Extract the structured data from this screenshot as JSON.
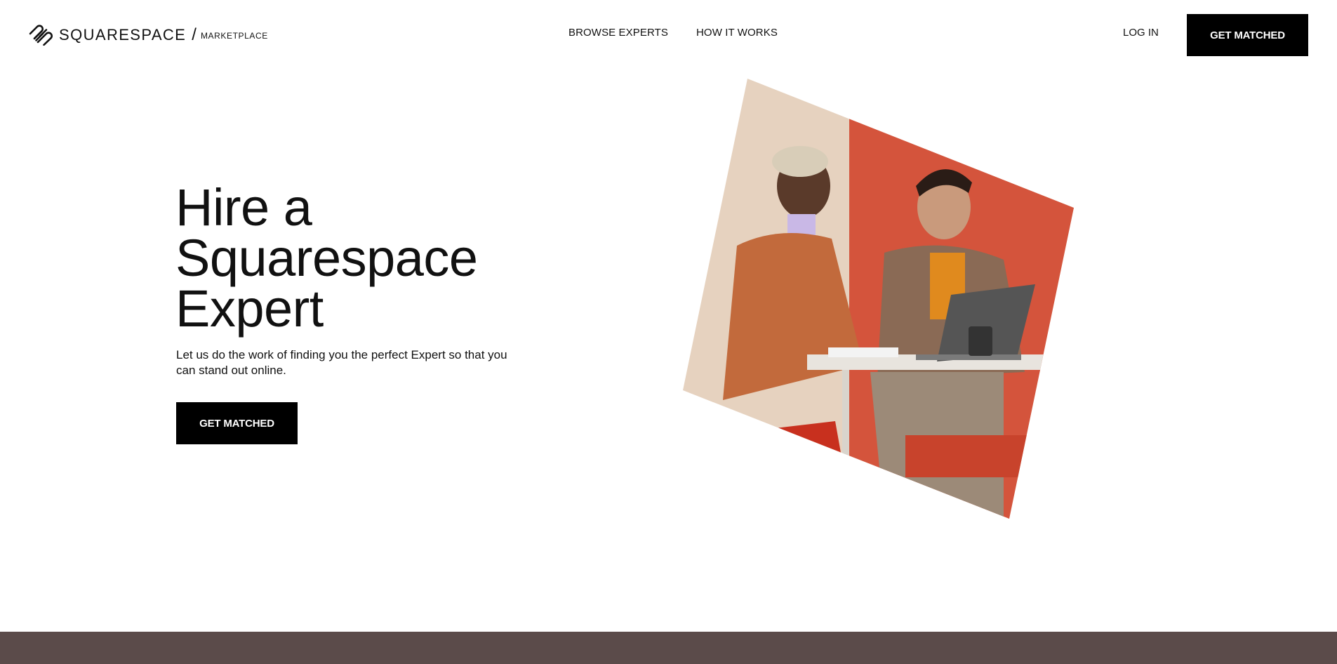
{
  "header": {
    "logo_word": "SQUARESPACE",
    "logo_slash": "/",
    "logo_sub": "MARKETPLACE",
    "nav": [
      "BROWSE EXPERTS",
      "HOW IT WORKS"
    ],
    "login_label": "LOG IN",
    "cta_label": "GET MATCHED"
  },
  "hero": {
    "title_line1": "Hire a",
    "title_line2": "Squarespace",
    "title_line3": "Expert",
    "subtitle": "Let us do the work of finding you the perfect Expert so that you can stand out online.",
    "cta_label": "GET MATCHED"
  },
  "colors": {
    "button_bg": "#000000",
    "band": "#5b4b4a",
    "photo_red": "#d4543c",
    "photo_beige": "#e6d2bf"
  },
  "icons": {
    "logo": "squarespace-logo-icon"
  }
}
